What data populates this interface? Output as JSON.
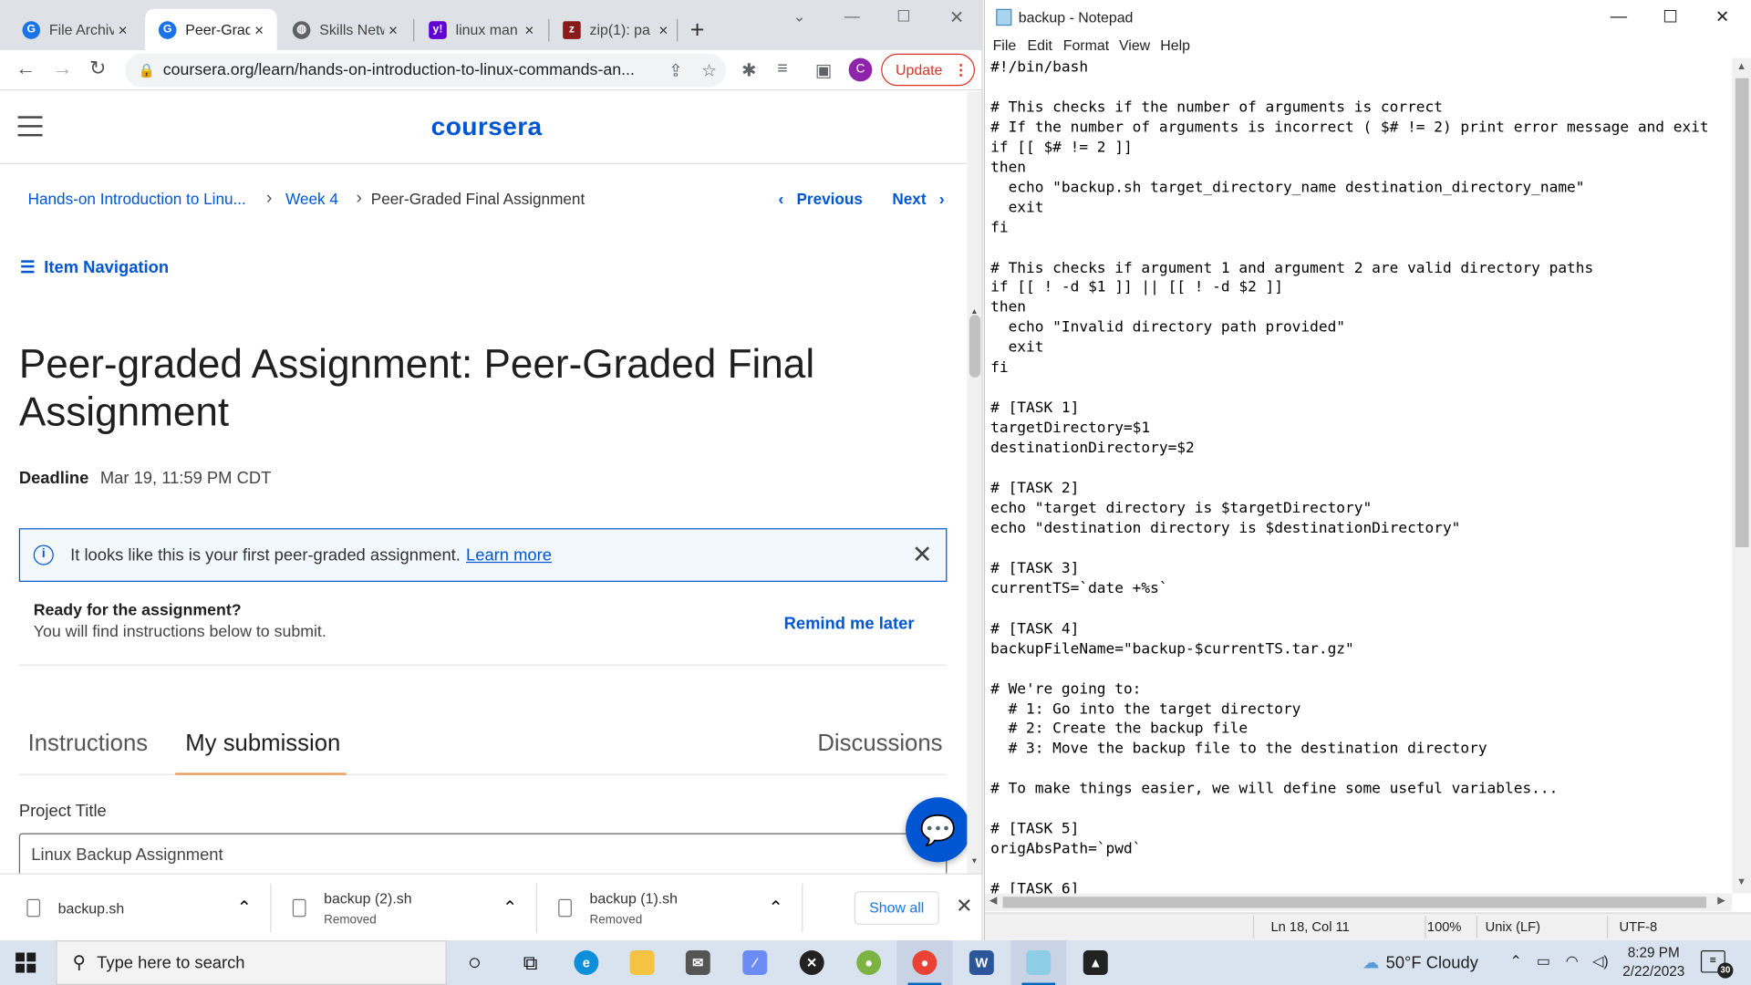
{
  "browser": {
    "tabs": [
      {
        "label": "File Archiv",
        "favicon": "chrome-icon",
        "color": "#1a73e8",
        "glyph": "G"
      },
      {
        "label": "Peer-Grad",
        "favicon": "chrome-icon",
        "color": "#1a73e8",
        "glyph": "G"
      },
      {
        "label": "Skills Netw",
        "favicon": "globe-icon",
        "color": "#5f6368",
        "glyph": "◍"
      },
      {
        "label": "linux man",
        "favicon": "yahoo-icon",
        "color": "#6001d2",
        "glyph": "y!"
      },
      {
        "label": "zip(1): pa",
        "favicon": "manpage-icon",
        "color": "#8b1a1a",
        "glyph": "z"
      }
    ],
    "tab_close": "×",
    "new_tab": "+",
    "url": "coursera.org/learn/hands-on-introduction-to-linux-commands-an...",
    "update_label": "Update",
    "profile_initial": "C"
  },
  "page": {
    "logo": "coursera",
    "breadcrumb": {
      "course": "Hands-on Introduction to Linu...",
      "week": "Week 4",
      "current": "Peer-Graded Final Assignment"
    },
    "previous_label": "Previous",
    "next_label": "Next",
    "item_navigation": "Item Navigation",
    "title": "Peer-graded Assignment: Peer-Graded Final Assignment",
    "deadline_label": "Deadline",
    "deadline_value": "Mar 19, 11:59 PM CDT",
    "info_text": "It looks like this is your first peer-graded assignment.",
    "info_link": "Learn more",
    "ready_heading": "Ready for the assignment?",
    "ready_sub": "You will find instructions below to submit.",
    "remind_label": "Remind me later",
    "tabs": {
      "instructions": "Instructions",
      "submission": "My submission",
      "discussions": "Discussions"
    },
    "project_title_label": "Project Title",
    "project_title_value": "Linux Backup Assignment",
    "accent": "#0056d2"
  },
  "downloads": {
    "items": [
      {
        "name": "backup.sh",
        "status": ""
      },
      {
        "name": "backup (2).sh",
        "status": "Removed"
      },
      {
        "name": "backup (1).sh",
        "status": "Removed"
      }
    ],
    "show_all": "Show all"
  },
  "notepad": {
    "title": "backup - Notepad",
    "menu": [
      "File",
      "Edit",
      "Format",
      "View",
      "Help"
    ],
    "content": "#!/bin/bash\n\n# This checks if the number of arguments is correct\n# If the number of arguments is incorrect ( $# != 2) print error message and exit\nif [[ $# != 2 ]]\nthen\n  echo \"backup.sh target_directory_name destination_directory_name\"\n  exit\nfi\n\n# This checks if argument 1 and argument 2 are valid directory paths\nif [[ ! -d $1 ]] || [[ ! -d $2 ]]\nthen\n  echo \"Invalid directory path provided\"\n  exit\nfi\n\n# [TASK 1]\ntargetDirectory=$1\ndestinationDirectory=$2\n\n# [TASK 2]\necho \"target directory is $targetDirectory\"\necho \"destination directory is $destinationDirectory\"\n\n# [TASK 3]\ncurrentTS=`date +%s`\n\n# [TASK 4]\nbackupFileName=\"backup-$currentTS.tar.gz\"\n\n# We're going to:\n  # 1: Go into the target directory\n  # 2: Create the backup file\n  # 3: Move the backup file to the destination directory\n\n# To make things easier, we will define some useful variables...\n\n# [TASK 5]\norigAbsPath=`pwd`\n\n# [TASK 6]",
    "status": {
      "position": "Ln 18, Col 11",
      "zoom": "100%",
      "eol": "Unix (LF)",
      "encoding": "UTF-8"
    }
  },
  "taskbar": {
    "search_placeholder": "Type here to search",
    "weather": "50°F  Cloudy",
    "time": "8:29 PM",
    "date": "2/22/2023",
    "notification_count": "30"
  }
}
